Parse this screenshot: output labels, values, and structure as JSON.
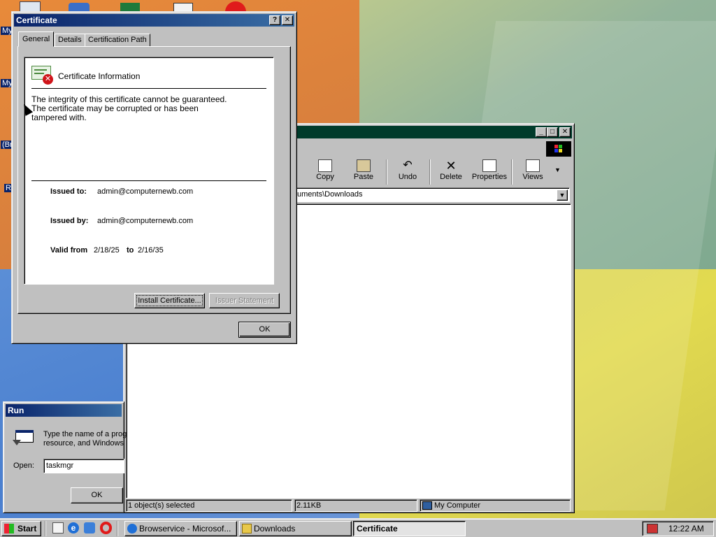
{
  "desktop": {
    "icon_labels": [
      "My",
      "My",
      "(Br",
      "R"
    ]
  },
  "certificate": {
    "title": "Certificate",
    "help_btn": "?",
    "close_btn": "✕",
    "tabs": [
      "General",
      "Details",
      "Certification Path"
    ],
    "info_heading": "Certificate Information",
    "warning": "The integrity of this certificate cannot be guaranteed.\nThe certificate may be corrupted or has been\ntampered with.",
    "issued_to_label": "Issued to:",
    "issued_to_value": "admin@computernewb.com",
    "issued_by_label": "Issued by:",
    "issued_by_value": "admin@computernewb.com",
    "valid_from_label": "Valid from",
    "valid_from_value": "2/18/25",
    "valid_to_label": "to",
    "valid_to_value": "2/16/35",
    "install_btn": "Install Certificate...",
    "issuer_btn": "Issuer Statement",
    "ok_btn": "OK"
  },
  "explorer": {
    "toolbar": [
      "Copy",
      "Paste",
      "Undo",
      "Delete",
      "Properties",
      "Views"
    ],
    "address": "uments\\Downloads",
    "status_selected": "1 object(s) selected",
    "status_size": "2.11KB",
    "status_zone": "My Computer"
  },
  "run": {
    "title": "Run",
    "description": "Type the name of a prog\nresource, and Windows",
    "open_label": "Open:",
    "open_value": "taskmgr",
    "ok_btn": "OK"
  },
  "taskbar": {
    "start": "Start",
    "tasks": [
      "Browservice - Microsof...",
      "Downloads",
      "Certificate"
    ],
    "clock": "12:22 AM"
  },
  "colors": {
    "title_active": "#0a246a",
    "title_inactive_dark": "#003b2b",
    "face": "#c0c0c0"
  }
}
